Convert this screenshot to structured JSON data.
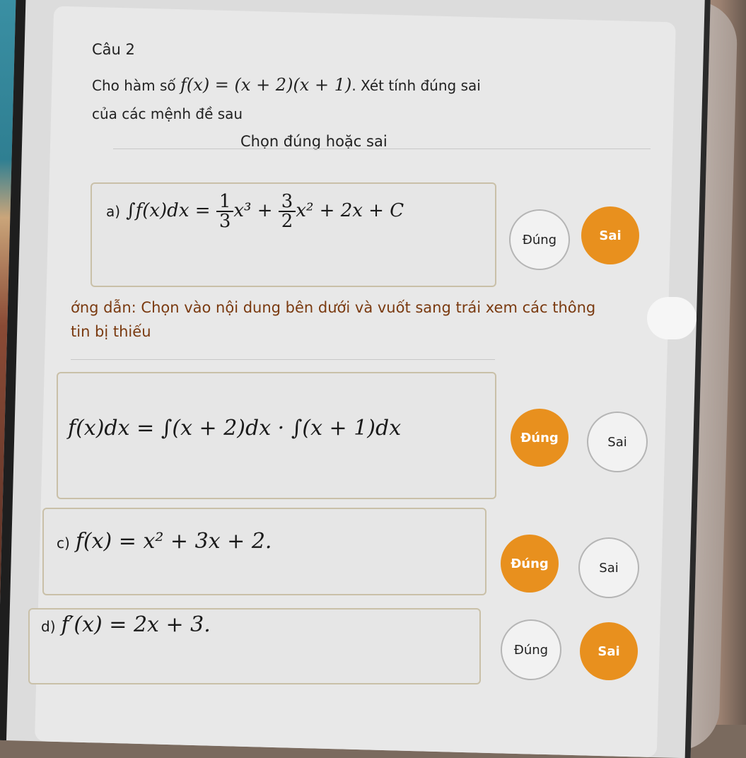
{
  "question": {
    "number": "Câu 2",
    "text_prefix": "Cho hàm số",
    "function": "f(x) = (x + 2)(x + 1)",
    "text_suffix": ". Xét tính đúng sai của các mệnh đề sau",
    "mode": "Chọn đúng hoặc sai"
  },
  "hint": "ớng dẫn: Chọn vào nội dung bên dưới và vuốt sang trái xem các thông tin bị thiếu",
  "true_label": "Đúng",
  "false_label": "Sai",
  "statements": [
    {
      "label": "a)",
      "formula_left": "∫f(x)dx =",
      "frac1_num": "1",
      "frac1_den": "3",
      "term1": "x³ +",
      "frac2_num": "3",
      "frac2_den": "2",
      "term2": "x² + 2x + C",
      "selected": "Sai"
    },
    {
      "label": "",
      "formula": "f(x)dx = ∫(x + 2)dx · ∫(x + 1)dx",
      "selected": "Đúng"
    },
    {
      "label": "c)",
      "formula": "f(x) = x² + 3x + 2.",
      "selected": "Đúng"
    },
    {
      "label": "d)",
      "formula": "f′(x) = 2x + 3.",
      "selected": "Sai"
    }
  ]
}
